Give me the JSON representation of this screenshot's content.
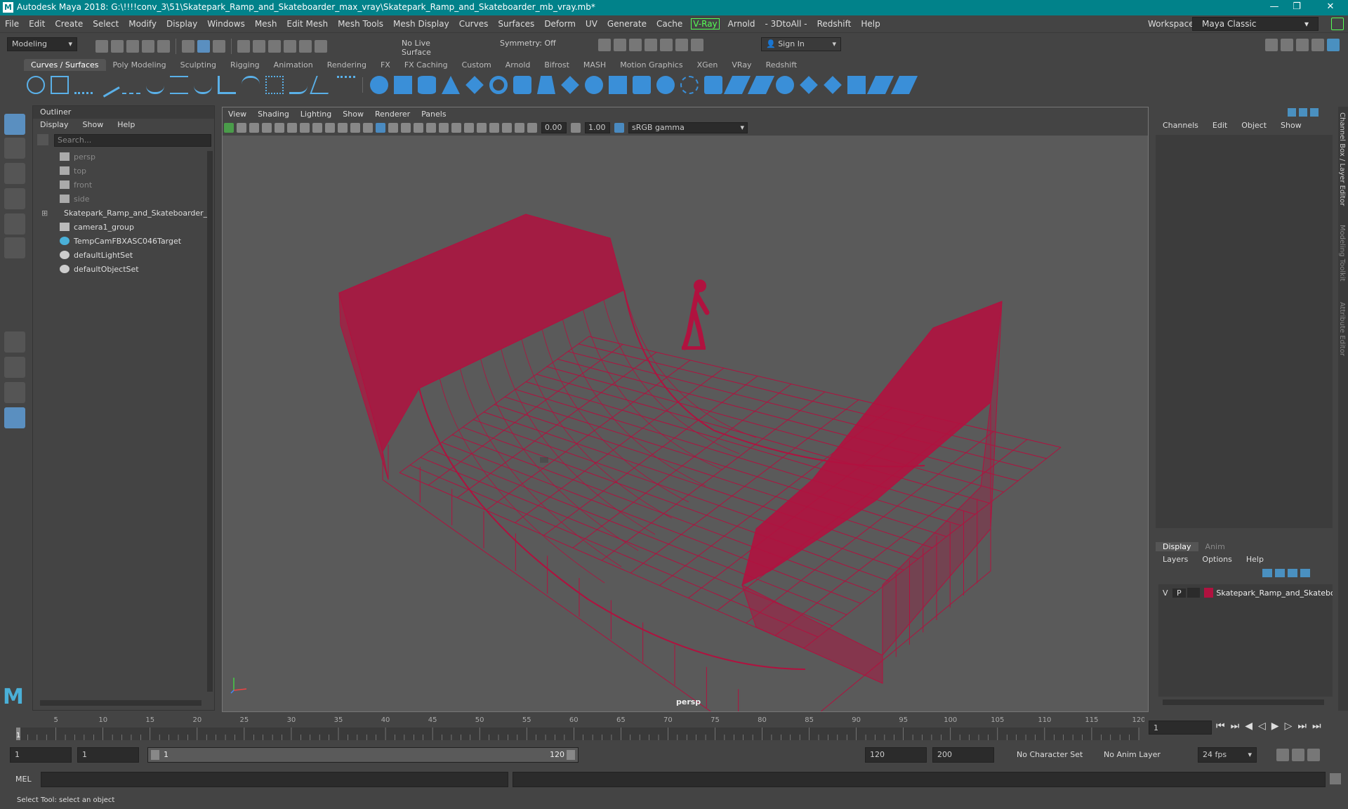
{
  "titlebar": {
    "title": "Autodesk Maya 2018: G:\\!!!!conv_3\\51\\Skatepark_Ramp_and_Skateboarder_max_vray\\Skatepark_Ramp_and_Skateboarder_mb_vray.mb*",
    "logo": "M",
    "minimize": "—",
    "maximize": "❐",
    "close": "✕"
  },
  "menubar": {
    "items": [
      "File",
      "Edit",
      "Create",
      "Select",
      "Modify",
      "Display",
      "Windows",
      "Mesh",
      "Edit Mesh",
      "Mesh Tools",
      "Mesh Display",
      "Curves",
      "Surfaces",
      "Deform",
      "UV",
      "Generate",
      "Cache"
    ],
    "vray": "V-Ray",
    "items2": [
      "Arnold",
      "- 3DtoAll -",
      "Redshift",
      "Help"
    ],
    "workspace_label": "Workspace :",
    "workspace_value": "Maya Classic"
  },
  "statusline": {
    "mode": "Modeling",
    "live_surface": "No Live Surface",
    "symmetry": "Symmetry: Off",
    "sign_in": "Sign In"
  },
  "shelf": {
    "tabs": [
      "Curves / Surfaces",
      "Poly Modeling",
      "Sculpting",
      "Rigging",
      "Animation",
      "Rendering",
      "FX",
      "FX Caching",
      "Custom",
      "Arnold",
      "Bifrost",
      "MASH",
      "Motion Graphics",
      "XGen",
      "VRay",
      "Redshift"
    ],
    "active": "Curves / Surfaces"
  },
  "outliner": {
    "title": "Outliner",
    "menu": [
      "Display",
      "Show",
      "Help"
    ],
    "search_placeholder": "Search...",
    "items": [
      {
        "label": "persp",
        "icon": "camera-icon",
        "dim": true
      },
      {
        "label": "top",
        "icon": "camera-icon",
        "dim": true
      },
      {
        "label": "front",
        "icon": "camera-icon",
        "dim": true
      },
      {
        "label": "side",
        "icon": "camera-icon",
        "dim": true
      },
      {
        "label": "Skatepark_Ramp_and_Skateboarder_",
        "icon": "transform-icon",
        "dim": false
      },
      {
        "label": "camera1_group",
        "icon": "group-icon",
        "dim": false
      },
      {
        "label": "TempCamFBXASC046Target",
        "icon": "transform-icon",
        "dim": false
      },
      {
        "label": "defaultLightSet",
        "icon": "set-icon",
        "dim": false
      },
      {
        "label": "defaultObjectSet",
        "icon": "set-icon",
        "dim": false
      }
    ]
  },
  "viewport": {
    "menu": [
      "View",
      "Shading",
      "Lighting",
      "Show",
      "Renderer",
      "Panels"
    ],
    "near": "0.00",
    "far": "1.00",
    "colorspace": "sRGB gamma",
    "camera_label": "persp",
    "wire_color": "#b0123f"
  },
  "channelbox": {
    "menu": [
      "Channels",
      "Edit",
      "Object",
      "Show"
    ],
    "side_tabs": [
      "Channel Box / Layer Editor",
      "Modeling Toolkit",
      "Attribute Editor"
    ]
  },
  "layers": {
    "tabs": [
      "Display",
      "Anim"
    ],
    "active": "Display",
    "menu": [
      "Layers",
      "Options",
      "Help"
    ],
    "row": {
      "v": "V",
      "p": "P",
      "name": "Skatepark_Ramp_and_Skatebo",
      "color": "#b0123f"
    }
  },
  "timeline": {
    "ticks": [
      "5",
      "10",
      "15",
      "20",
      "25",
      "30",
      "35",
      "40",
      "45",
      "50",
      "55",
      "60",
      "65",
      "70",
      "75",
      "80",
      "85",
      "90",
      "95",
      "100",
      "105",
      "110",
      "115",
      "120"
    ],
    "start_marker": "1",
    "current_frame": "1"
  },
  "range": {
    "start": "1",
    "playback_start": "1",
    "range_start": "1",
    "range_end": "120",
    "playback_end": "120",
    "end": "200",
    "character_set": "No Character Set",
    "anim_layer": "No Anim Layer",
    "fps": "24 fps"
  },
  "cmdline": {
    "label": "MEL"
  },
  "helpline": {
    "text": "Select Tool: select an object"
  }
}
